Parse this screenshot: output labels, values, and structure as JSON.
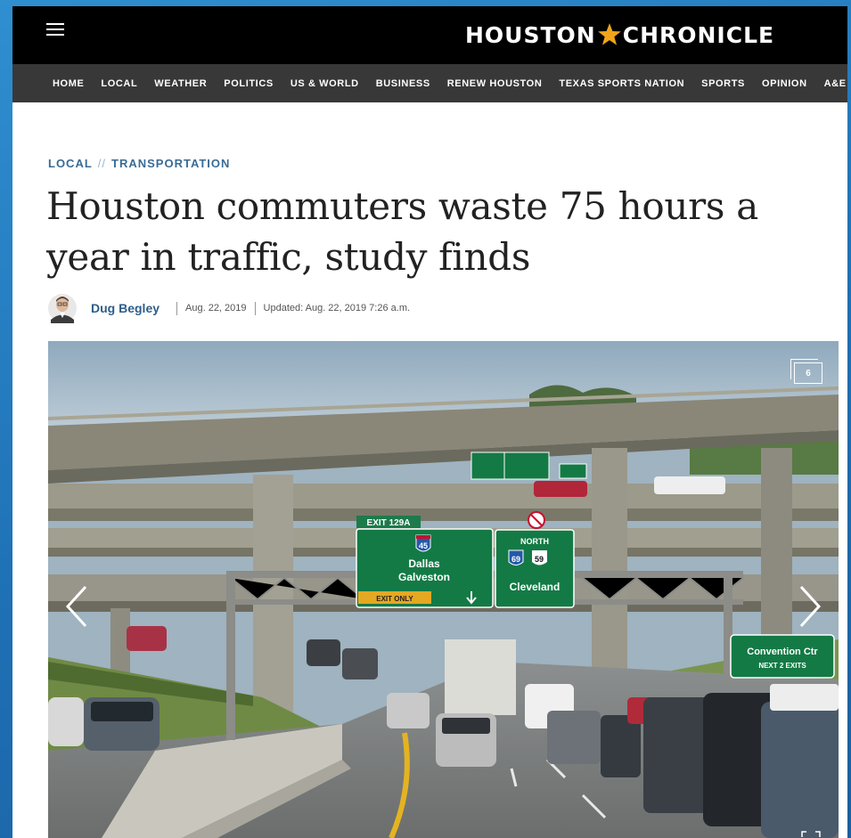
{
  "header": {
    "logo_left": "HOUSTON",
    "logo_right": "CHRONICLE",
    "menu_icon": "hamburger-menu-icon",
    "star_icon": "star-icon",
    "brand_color": "#f2a51a"
  },
  "nav": {
    "items": [
      {
        "label": "HOME"
      },
      {
        "label": "LOCAL"
      },
      {
        "label": "WEATHER"
      },
      {
        "label": "POLITICS"
      },
      {
        "label": "US & WORLD"
      },
      {
        "label": "BUSINESS"
      },
      {
        "label": "RENEW HOUSTON"
      },
      {
        "label": "TEXAS SPORTS NATION"
      },
      {
        "label": "SPORTS"
      },
      {
        "label": "OPINION"
      },
      {
        "label": "A&E"
      }
    ]
  },
  "article": {
    "kicker_section": "LOCAL",
    "kicker_sep": "//",
    "kicker_topic": "TRANSPORTATION",
    "headline": "Houston commuters waste 75 hours a year in traffic, study finds",
    "author": "Dug Begley",
    "date": "Aug. 22, 2019",
    "updated": "Updated: Aug. 22, 2019 7:26 a.m."
  },
  "gallery": {
    "photo_count": "6",
    "prev_icon": "chevron-left-icon",
    "next_icon": "chevron-right-icon",
    "fullscreen_icon": "fullscreen-icon",
    "signs": {
      "exit": "EXIT 129A",
      "interstate": "45",
      "dest1": "Dallas",
      "dest2": "Galveston",
      "exit_only": "EXIT ONLY",
      "north": "NORTH",
      "us69": "69",
      "us59": "59",
      "cleveland": "Cleveland",
      "convention": "Convention Ctr",
      "next_exits": "NEXT 2 EXITS"
    }
  }
}
